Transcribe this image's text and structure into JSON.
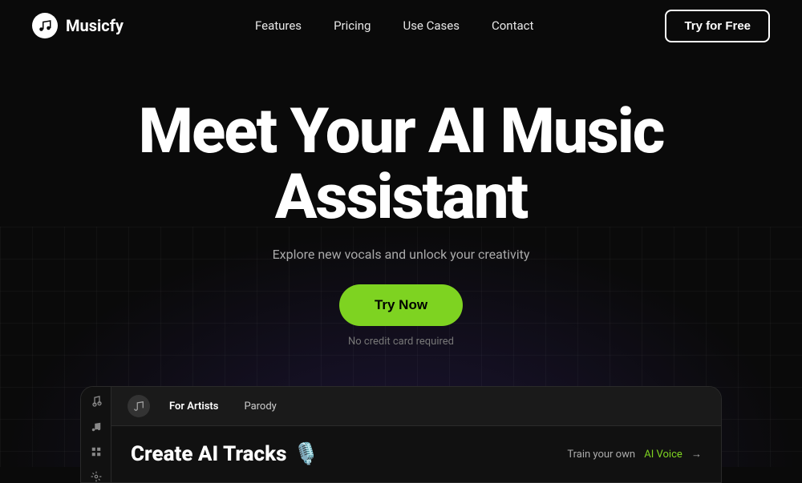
{
  "navbar": {
    "logo_text": "Musicfy",
    "nav_items": [
      {
        "label": "Features",
        "id": "features"
      },
      {
        "label": "Pricing",
        "id": "pricing"
      },
      {
        "label": "Use Cases",
        "id": "use-cases"
      },
      {
        "label": "Contact",
        "id": "contact"
      }
    ],
    "cta_label": "Try for Free"
  },
  "hero": {
    "title_line1": "Meet Your AI Music",
    "title_line2": "Assistant",
    "subtitle": "Explore new vocals and unlock your creativity",
    "cta_label": "Try Now",
    "no_credit_text": "No credit card required"
  },
  "app_preview": {
    "logo_icon": "music-note",
    "tabs": [
      {
        "label": "For Artists",
        "active": true
      },
      {
        "label": "Parody",
        "active": false
      }
    ],
    "content_title": "Create AI Tracks",
    "emoji": "🎙️",
    "train_voice_label": "Train your own",
    "train_voice_highlight": "AI Voice",
    "train_voice_arrow": "→"
  },
  "colors": {
    "background": "#0a0a0a",
    "accent_green": "#7ed321",
    "text_primary": "#ffffff",
    "text_muted": "#aaaaaa",
    "card_bg": "#111111"
  }
}
